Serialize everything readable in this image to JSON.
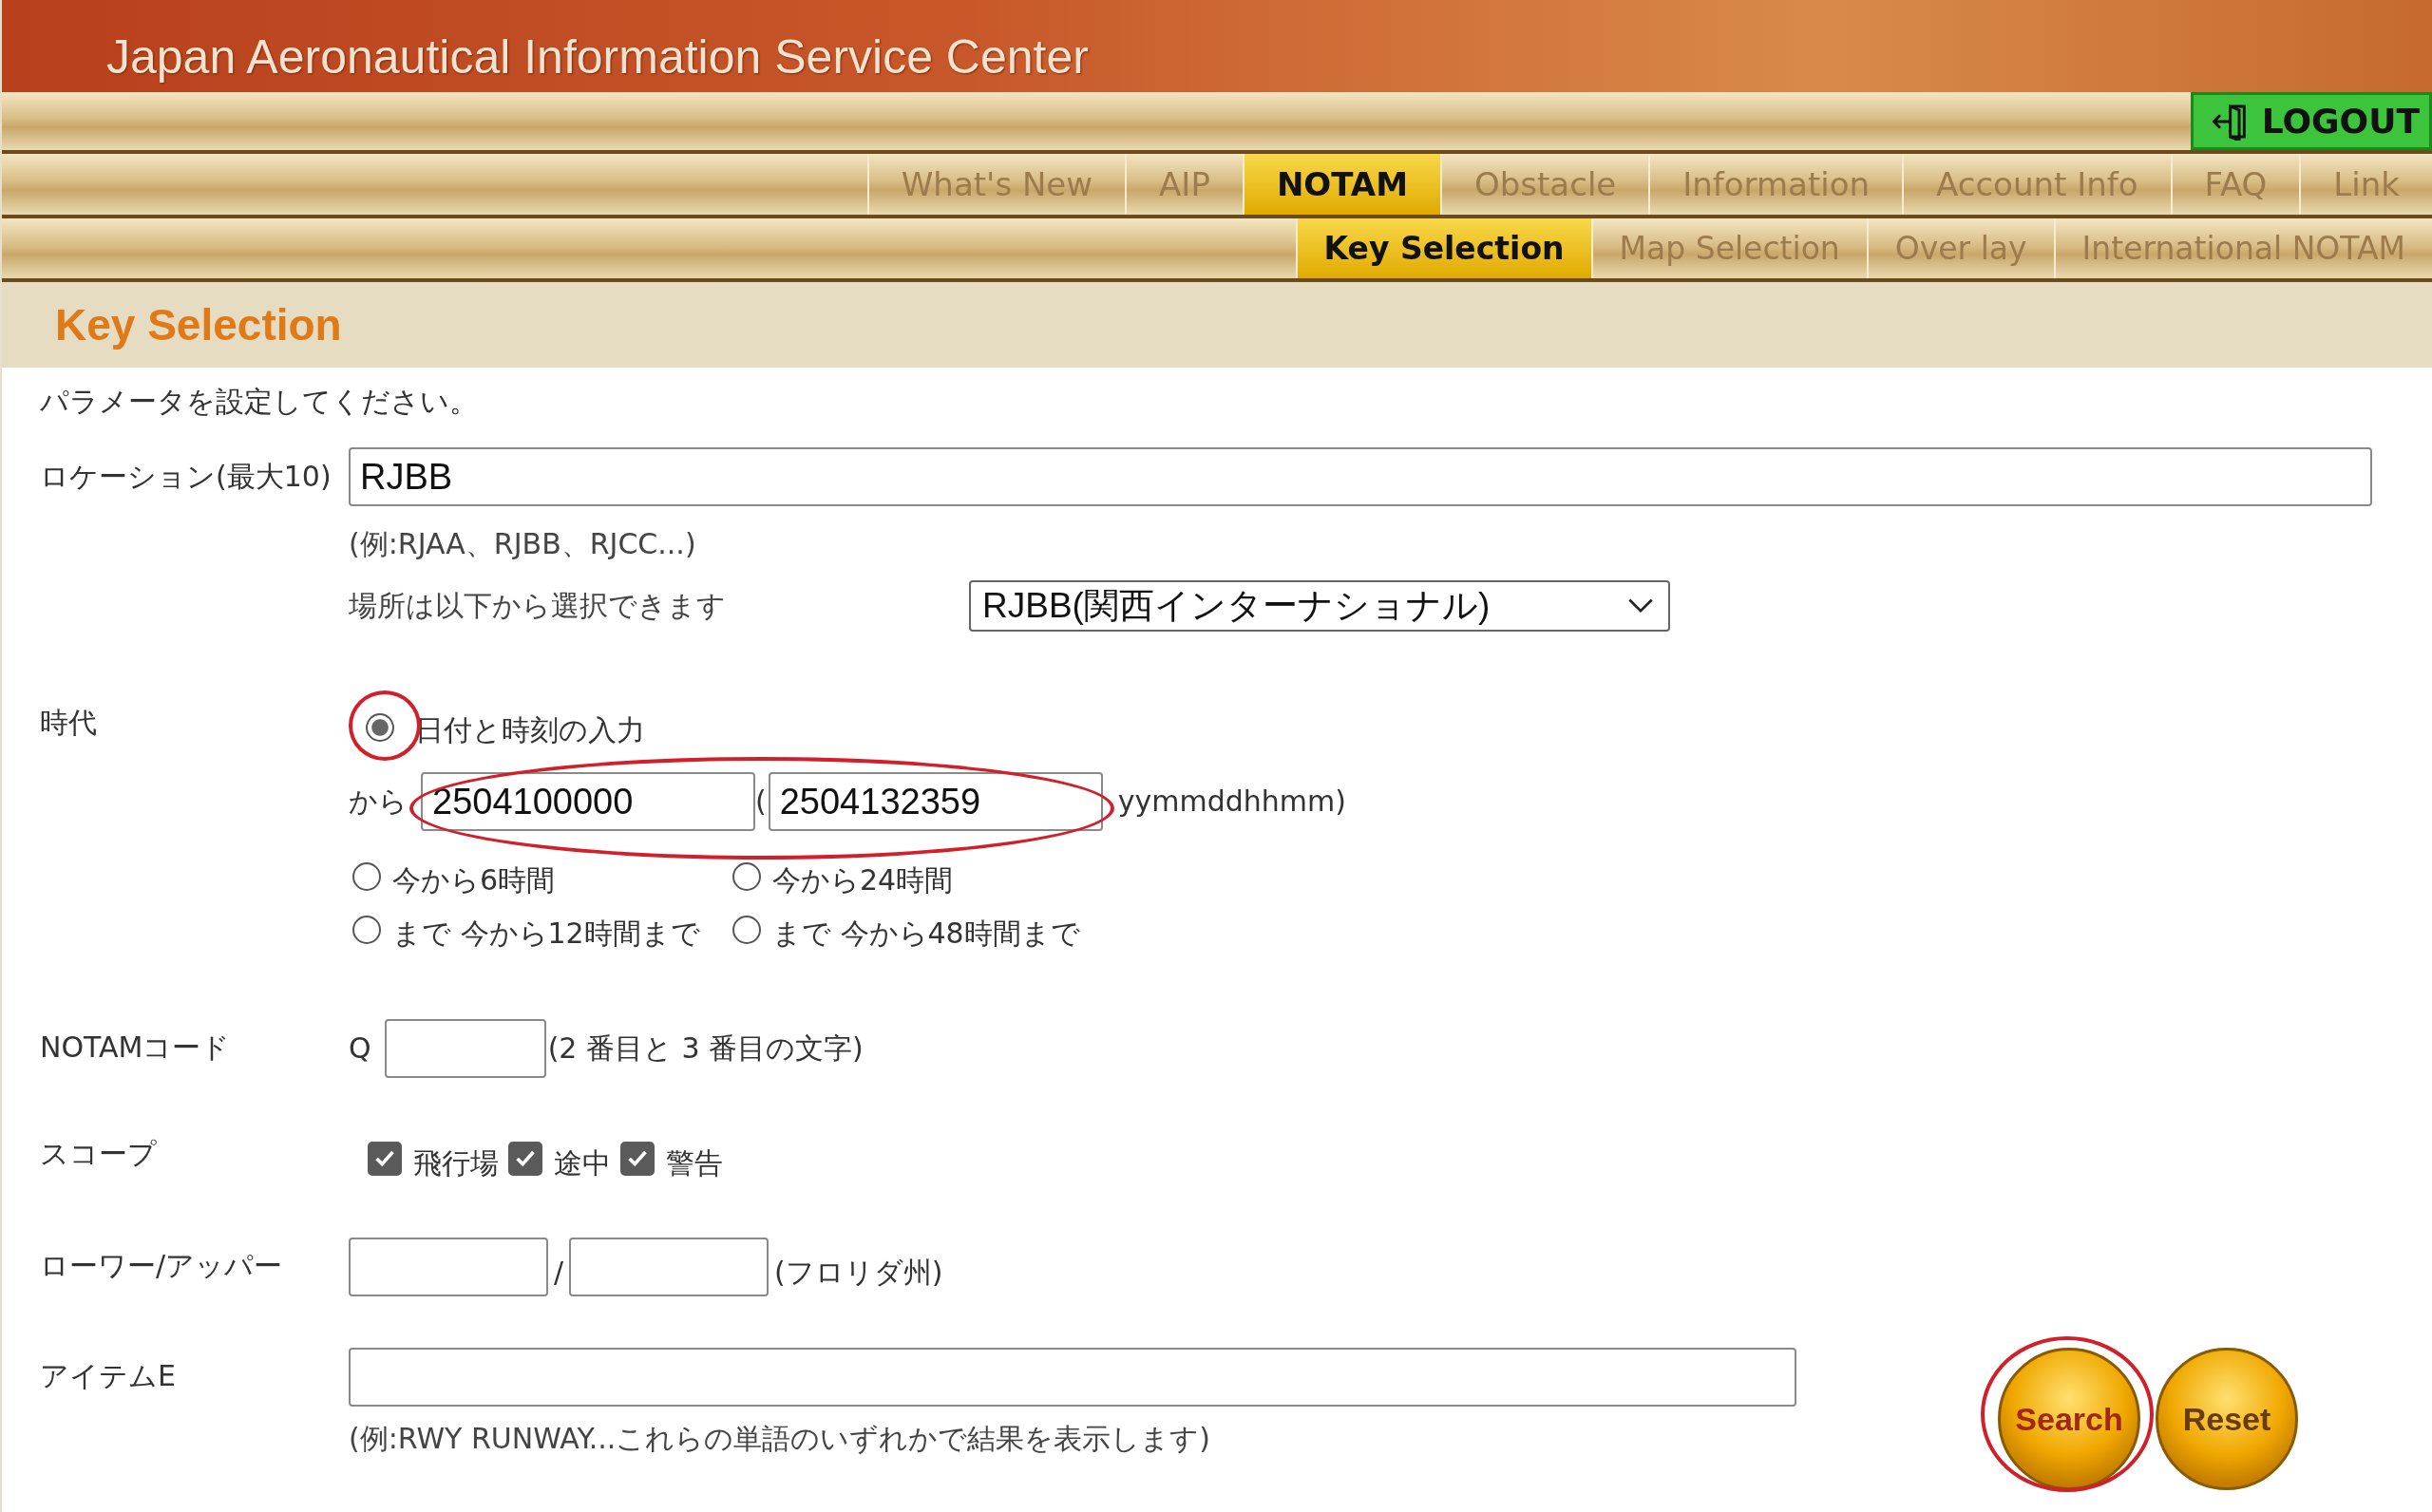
{
  "header": {
    "title": "Japan Aeronautical Information Service Center",
    "logout": "LOGOUT"
  },
  "nav": [
    {
      "label": "What's New",
      "selected": false
    },
    {
      "label": "AIP",
      "selected": false
    },
    {
      "label": "NOTAM",
      "selected": true
    },
    {
      "label": "Obstacle",
      "selected": false
    },
    {
      "label": "Information",
      "selected": false
    },
    {
      "label": "Account Info",
      "selected": false
    },
    {
      "label": "FAQ",
      "selected": false
    },
    {
      "label": "Link",
      "selected": false
    }
  ],
  "subnav": [
    {
      "label": "Key Selection",
      "selected": true
    },
    {
      "label": "Map Selection",
      "selected": false
    },
    {
      "label": "Over lay",
      "selected": false
    },
    {
      "label": "International NOTAM",
      "selected": false
    }
  ],
  "section_title": "Key Selection",
  "form": {
    "instruction": "パラメータを設定してください。",
    "location": {
      "label": "ロケーション(最大10)",
      "value": "RJBB",
      "example": "(例:RJAA、RJBB、RJCC...)",
      "select_label": "場所は以下から選択できます",
      "select_value": "RJBB(関西インターナショナル)"
    },
    "period": {
      "label": "時代",
      "main_option": {
        "label": "日付と時刻の入力",
        "selected": true,
        "highlighted": true
      },
      "from_label": "から",
      "from_value": "2504100000",
      "paren": "(",
      "to_value": "2504132359",
      "format": "yymmddhhmm)",
      "range_highlighted": true,
      "options": [
        {
          "label": "今から6時間",
          "selected": false
        },
        {
          "label": "今から24時間",
          "selected": false
        },
        {
          "label": "まで 今から12時間まで",
          "selected": false
        },
        {
          "label": "まで 今から48時間まで",
          "selected": false
        }
      ]
    },
    "notam_code": {
      "label": "NOTAMコード",
      "prefix": "Q",
      "hint": "(2 番目と 3 番目の文字)"
    },
    "scope": {
      "label": "スコープ",
      "items": [
        {
          "label": "飛行場",
          "checked": true
        },
        {
          "label": "途中",
          "checked": true
        },
        {
          "label": "警告",
          "checked": true
        }
      ]
    },
    "lower_upper": {
      "label": "ローワー/アッパー",
      "separator": "/",
      "hint": "(フロリダ州)"
    },
    "item_e": {
      "label": "アイテムE",
      "example": "(例:RWY RUNWAY...これらの単語のいずれかで結果を表示します)"
    }
  },
  "buttons": [
    {
      "label": "Search",
      "kind": "search",
      "highlighted": true
    },
    {
      "label": "Reset",
      "kind": "reset",
      "highlighted": false
    }
  ]
}
